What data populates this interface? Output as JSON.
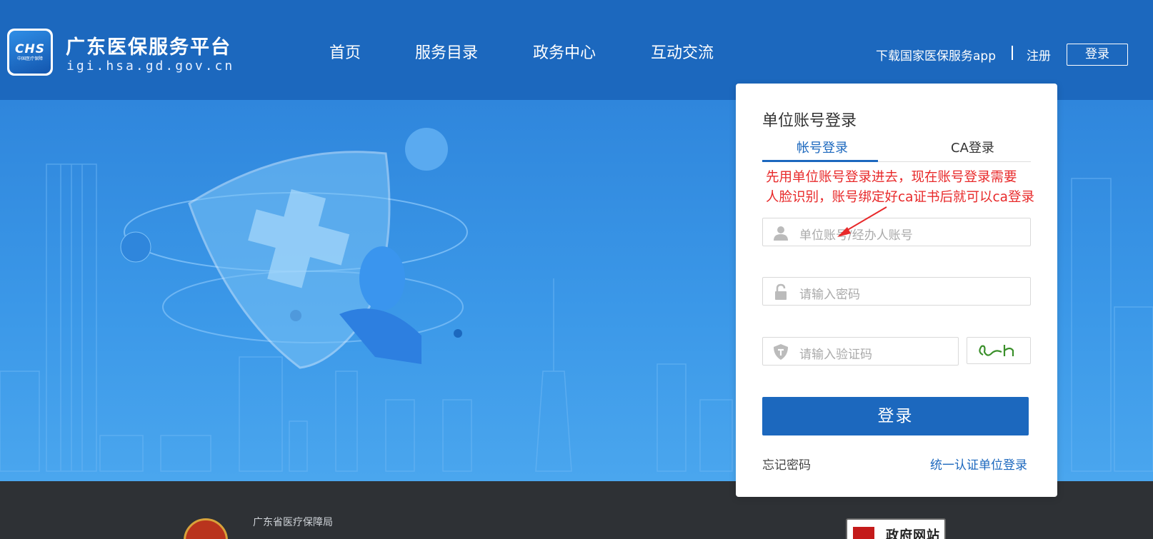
{
  "header": {
    "logo_text": "CHS",
    "logo_subtext": "中国医疗保障",
    "site_title": "广东医保服务平台",
    "site_domain": "igi.hsa.gd.gov.cn",
    "nav": [
      {
        "label": "首页"
      },
      {
        "label": "服务目录"
      },
      {
        "label": "政务中心"
      },
      {
        "label": "互动交流"
      }
    ],
    "download_app": "下载国家医保服务app",
    "register": "注册",
    "login": "登录"
  },
  "login_card": {
    "title": "单位账号登录",
    "tabs": [
      {
        "label": "帐号登录",
        "active": true
      },
      {
        "label": "CA登录",
        "active": false
      }
    ],
    "annotation_line1": "先用单位账号登录进去，现在账号登录需要",
    "annotation_line2": "人脸识别，账号绑定好ca证书后就可以ca登录",
    "account_placeholder": "单位账号/经办人账号",
    "password_placeholder": "请输入密码",
    "captcha_placeholder": "请输入验证码",
    "submit_label": "登录",
    "forgot_password": "忘记密码",
    "unified_login": "统一认证单位登录"
  },
  "footer": {
    "org_name": "广东省医疗保障局",
    "gov_badge": "政府网站"
  },
  "colors": {
    "primary": "#1c68be",
    "annotation": "#e8292a",
    "footer_bg": "#2e3135"
  },
  "icons": [
    "user-icon",
    "lock-icon",
    "shield-icon",
    "annotation-arrow-icon"
  ]
}
